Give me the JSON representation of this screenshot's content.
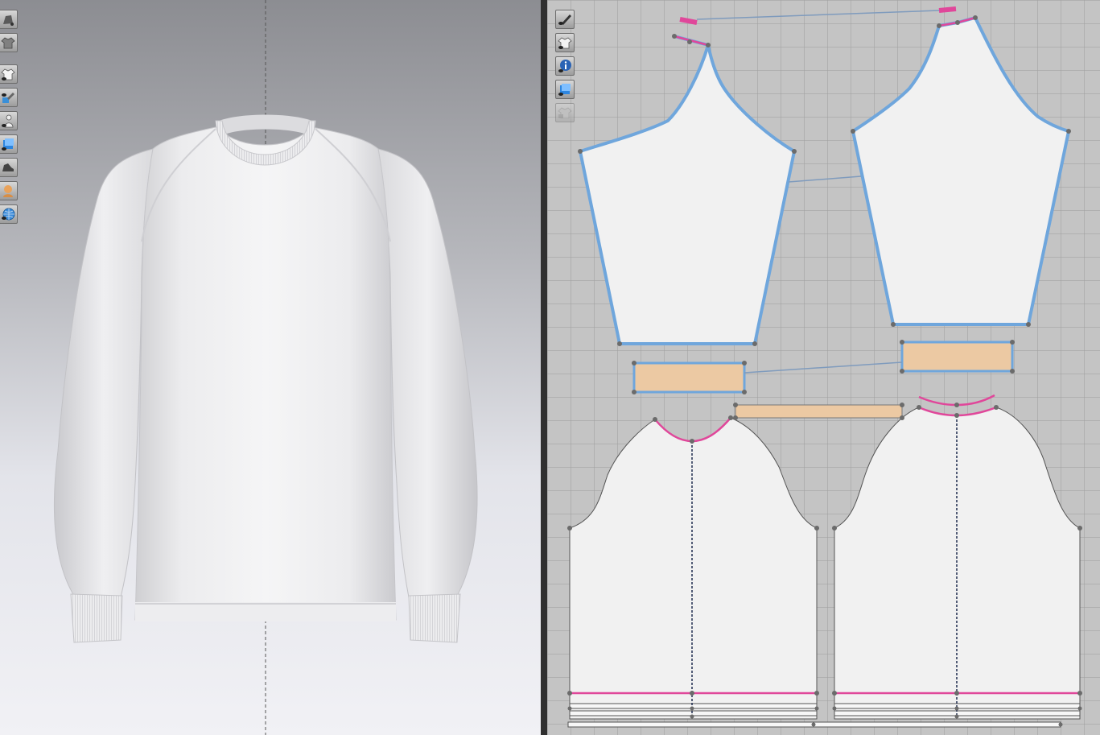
{
  "viewport3d": {
    "toolbar": [
      {
        "icon": "avatar-display-icon"
      },
      {
        "icon": "garment-shirt-icon"
      },
      {
        "icon": "show-garment-icon"
      },
      {
        "icon": "texture-edit-icon"
      },
      {
        "icon": "show-avatar-icon"
      },
      {
        "icon": "fabric-render-icon"
      },
      {
        "icon": "shoe-icon"
      },
      {
        "icon": "avatar-head-icon"
      },
      {
        "icon": "globe-environment-icon"
      }
    ]
  },
  "viewport2d": {
    "toolbar": [
      {
        "icon": "pen-visibility-icon",
        "enabled": true
      },
      {
        "icon": "show-garment-2d-icon",
        "enabled": true
      },
      {
        "icon": "info-icon",
        "enabled": true
      },
      {
        "icon": "fabric-layer-icon",
        "enabled": true
      },
      {
        "icon": "locked-garment-icon",
        "enabled": false
      }
    ]
  },
  "colors": {
    "seam_blue": "#6fa6dc",
    "seam_pink": "#e0479a",
    "rib_fabric": "#ecc9a3",
    "pattern_fabric": "#f1f1f1",
    "grid_background": "#c4c4c4"
  }
}
